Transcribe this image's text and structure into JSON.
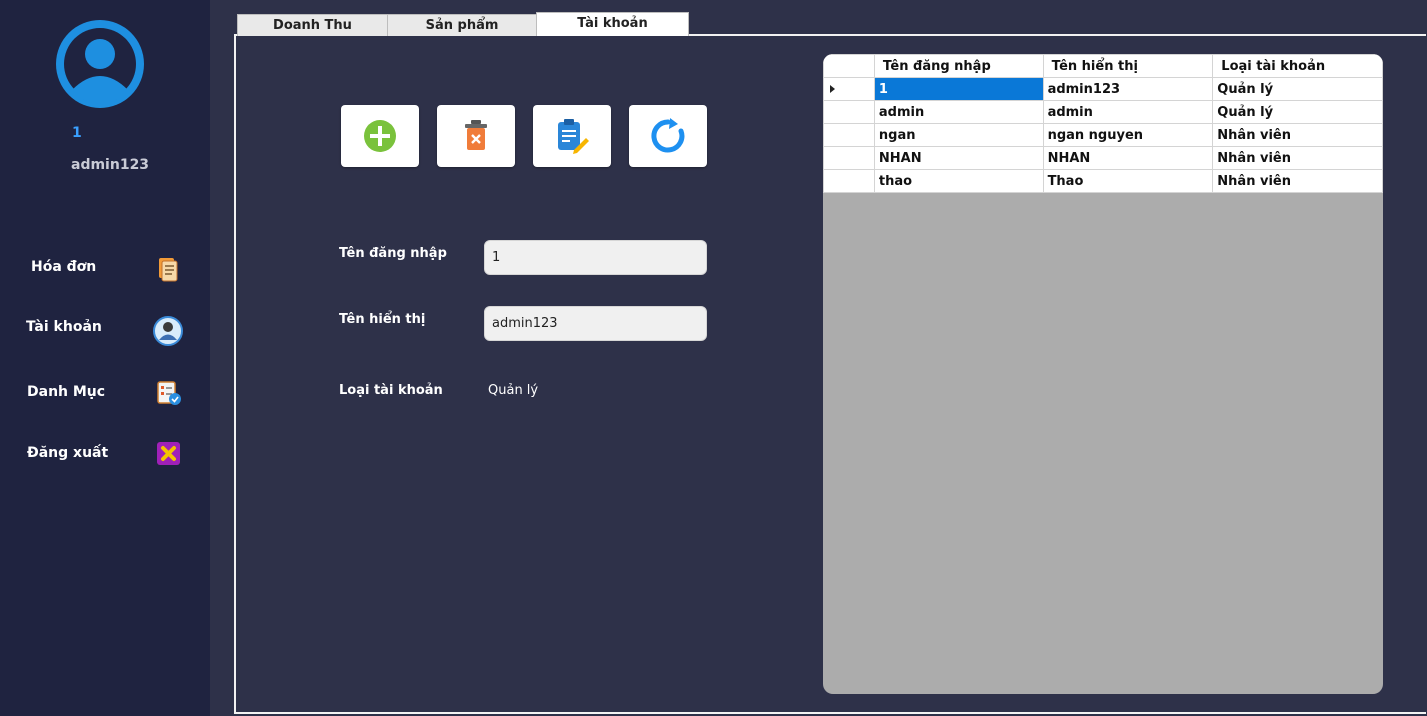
{
  "sidebar": {
    "user_id": "1",
    "user_name": "admin123",
    "items": [
      {
        "label": "Hóa đơn",
        "icon": "invoice-icon"
      },
      {
        "label": "Tài khoản",
        "icon": "account-icon"
      },
      {
        "label": "Danh Mục",
        "icon": "category-icon"
      },
      {
        "label": "Đăng xuất",
        "icon": "logout-icon"
      }
    ]
  },
  "tabs": [
    {
      "label": "Doanh Thu"
    },
    {
      "label": "Sản phẩm"
    },
    {
      "label": "Tài khoản",
      "active": true
    }
  ],
  "toolbar": [
    {
      "name": "add-button",
      "icon": "add-icon"
    },
    {
      "name": "delete-button",
      "icon": "trash-icon"
    },
    {
      "name": "edit-button",
      "icon": "edit-icon"
    },
    {
      "name": "refresh-button",
      "icon": "refresh-icon"
    }
  ],
  "form": {
    "username_label": "Tên đăng nhập",
    "username_value": "1",
    "display_label": "Tên hiển thị",
    "display_value": "admin123",
    "type_label": "Loại tài khoản",
    "type_value": "Quản lý"
  },
  "grid": {
    "columns": [
      "Tên đăng nhập",
      "Tên hiển thị",
      "Loại tài khoản"
    ],
    "rows": [
      [
        "1",
        "admin123",
        "Quản lý"
      ],
      [
        "admin",
        "admin",
        "Quản lý"
      ],
      [
        "ngan",
        "ngan nguyen",
        "Nhân viên"
      ],
      [
        "NHAN",
        "NHAN",
        "Nhân viên"
      ],
      [
        "thao",
        "Thao",
        "Nhân viên"
      ]
    ],
    "selected_row": 0
  },
  "colors": {
    "sidebar_bg": "#1f2340",
    "main_bg": "#2e3149",
    "accent": "#0a78d7"
  }
}
